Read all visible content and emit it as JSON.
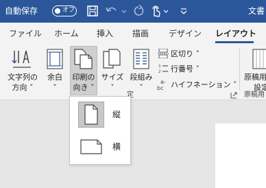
{
  "titlebar": {
    "autosave_label": "自動保存",
    "toggle_state": "オフ",
    "doc_fragment": "文書",
    "quick_access": [
      "save-icon",
      "undo-icon",
      "redo-icon",
      "touch-mode-icon",
      "customize-icon"
    ]
  },
  "tabs": [
    {
      "label": "ファイル"
    },
    {
      "label": "ホーム"
    },
    {
      "label": "挿入"
    },
    {
      "label": "描画"
    },
    {
      "label": "デザイン"
    },
    {
      "label": "レイアウト",
      "active": true
    }
  ],
  "ribbon": {
    "text_direction": {
      "line1": "文字列の",
      "line2": "方向 ˅"
    },
    "margins": {
      "line1": "余白",
      "line2": "˅"
    },
    "orientation": {
      "line1": "印刷の",
      "line2": "向き ˅"
    },
    "size": {
      "line1": "サイズ",
      "line2": "˅"
    },
    "columns": {
      "line1": "段組み",
      "line2": "˅"
    },
    "breaks": "区切り ˅",
    "line_numbers": "行番号 ˅",
    "hyphenation": "ハイフネーション ˅",
    "manuscript": {
      "line1": "原稿用",
      "line2": "設定"
    },
    "group_fragment": "定",
    "group_fragment_right": "原稿用"
  },
  "orientation_menu": {
    "items": [
      {
        "label": "縦",
        "selected": true
      },
      {
        "label": "横",
        "selected": false
      }
    ]
  },
  "colors": {
    "titlebar": "#2b579a",
    "ribbon": "#f3f3f3",
    "selected": "#cfcfcf"
  }
}
